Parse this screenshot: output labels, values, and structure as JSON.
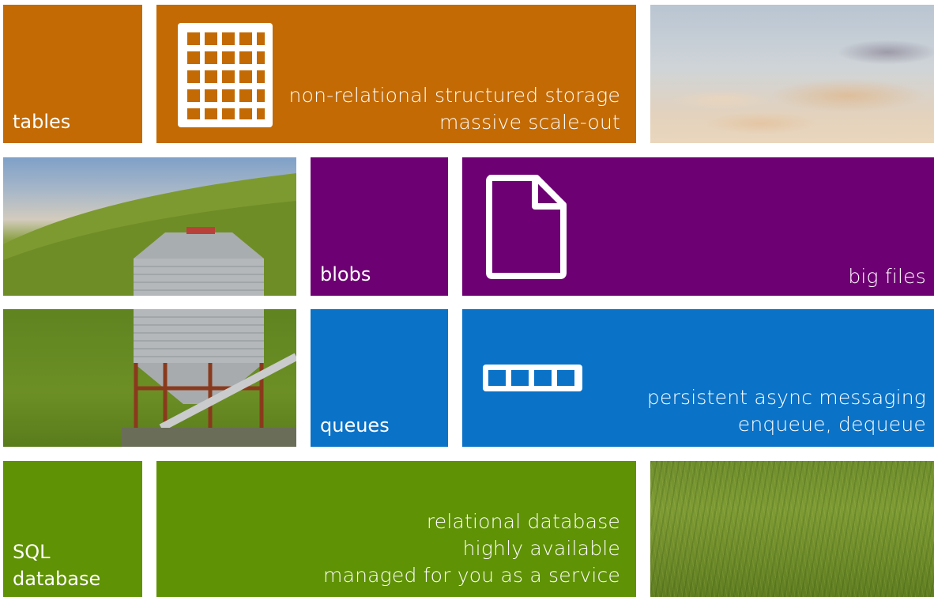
{
  "tiles": {
    "tables": {
      "label": "tables",
      "color": "#c36a04"
    },
    "tables_detail": {
      "icon": "table-grid-icon",
      "lines": [
        "non-relational structured storage",
        "massive scale-out"
      ]
    },
    "blobs": {
      "label": "blobs",
      "color": "#6d0072"
    },
    "blobs_detail": {
      "icon": "file-icon",
      "lines": [
        "big files"
      ]
    },
    "queues": {
      "label": "queues",
      "color": "#0a72c7"
    },
    "queues_detail": {
      "icon": "queue-icon",
      "lines": [
        "persistent async messaging",
        "enqueue, dequeue"
      ]
    },
    "sql": {
      "label_line1": "SQL",
      "label_line2": "database",
      "color": "#5f9204"
    },
    "sql_detail": {
      "lines": [
        "relational database",
        "highly available",
        "managed for you as a service"
      ]
    }
  },
  "photos": [
    "sky-photo",
    "silo-photo",
    "grass-photo"
  ]
}
